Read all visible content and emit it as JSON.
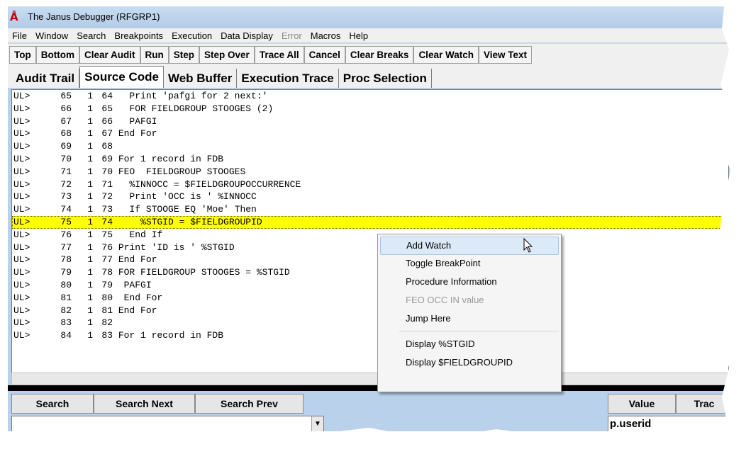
{
  "window": {
    "title": "The Janus Debugger (RFGRP1)"
  },
  "menu": [
    "File",
    "Window",
    "Search",
    "Breakpoints",
    "Execution",
    "Data Display",
    "Error",
    "Macros",
    "Help"
  ],
  "toolbar": [
    "Top",
    "Bottom",
    "Clear Audit",
    "Run",
    "Step",
    "Step Over",
    "Trace All",
    "Cancel",
    "Clear Breaks",
    "Clear Watch",
    "View Text"
  ],
  "tabs": [
    "Audit Trail",
    "Source Code",
    "Web Buffer",
    "Execution Trace",
    "Proc Selection"
  ],
  "active_tab": "Source Code",
  "code_lines": [
    {
      "prefix": "UL>",
      "line": "65",
      "level": "1",
      "src": "64",
      "text": "  Print 'pafgi for 2 next:'"
    },
    {
      "prefix": "UL>",
      "line": "66",
      "level": "1",
      "src": "65",
      "text": "  FOR FIELDGROUP STOOGES (2)"
    },
    {
      "prefix": "UL>",
      "line": "67",
      "level": "1",
      "src": "66",
      "text": "  PAFGI"
    },
    {
      "prefix": "UL>",
      "line": "68",
      "level": "1",
      "src": "67",
      "text": "End For"
    },
    {
      "prefix": "UL>",
      "line": "69",
      "level": "1",
      "src": "68",
      "text": ""
    },
    {
      "prefix": "UL>",
      "line": "70",
      "level": "1",
      "src": "69",
      "text": "For 1 record in FDB"
    },
    {
      "prefix": "UL>",
      "line": "71",
      "level": "1",
      "src": "70",
      "text": "FEO  FIELDGROUP STOOGES"
    },
    {
      "prefix": "UL>",
      "line": "72",
      "level": "1",
      "src": "71",
      "text": "  %INNOCC = $FIELDGROUPOCCURRENCE"
    },
    {
      "prefix": "UL>",
      "line": "73",
      "level": "1",
      "src": "72",
      "text": "  Print 'OCC is ' %INNOCC"
    },
    {
      "prefix": "UL>",
      "line": "74",
      "level": "1",
      "src": "73",
      "text": "  If STOOGE EQ 'Moe' Then"
    },
    {
      "prefix": "UL>",
      "line": "75",
      "level": "1",
      "src": "74",
      "text": "    %STGID = $FIELDGROUPID"
    },
    {
      "prefix": "UL>",
      "line": "76",
      "level": "1",
      "src": "75",
      "text": "  End If"
    },
    {
      "prefix": "UL>",
      "line": "77",
      "level": "1",
      "src": "76",
      "text": "Print 'ID is ' %STGID"
    },
    {
      "prefix": "UL>",
      "line": "78",
      "level": "1",
      "src": "77",
      "text": "End For"
    },
    {
      "prefix": "UL>",
      "line": "79",
      "level": "1",
      "src": "78",
      "text": "FOR FIELDGROUP STOOGES = %STGID"
    },
    {
      "prefix": "UL>",
      "line": "80",
      "level": "1",
      "src": "79",
      "text": " PAFGI"
    },
    {
      "prefix": "UL>",
      "line": "81",
      "level": "1",
      "src": "80",
      "text": " End For"
    },
    {
      "prefix": "UL>",
      "line": "82",
      "level": "1",
      "src": "81",
      "text": "End For"
    },
    {
      "prefix": "UL>",
      "line": "83",
      "level": "1",
      "src": "82",
      "text": ""
    },
    {
      "prefix": "UL>",
      "line": "84",
      "level": "1",
      "src": "83",
      "text": "For 1 record in FDB"
    }
  ],
  "highlighted_line": "75",
  "context_menu": {
    "items": [
      "Add Watch",
      "Toggle BreakPoint",
      "Procedure Information",
      "FEO OCC IN value",
      "Jump Here",
      "Display %STGID",
      "Display $FIELDGROUPID"
    ],
    "disabled": [
      "FEO OCC IN value"
    ],
    "hovered": "Add Watch"
  },
  "search_buttons": [
    "Search",
    "Search Next",
    "Search Prev"
  ],
  "value_buttons": [
    "Value",
    "Trac"
  ],
  "search_input": {
    "value": ""
  },
  "value_field": {
    "value": "p.userid"
  },
  "colors": {
    "highlight": "#ffff00",
    "window_frame": "#b9d1ea",
    "menu_hover": "#dce9f7"
  },
  "icons": [
    "app-icon",
    "dropdown-arrow-icon",
    "mouse-cursor-icon"
  ]
}
